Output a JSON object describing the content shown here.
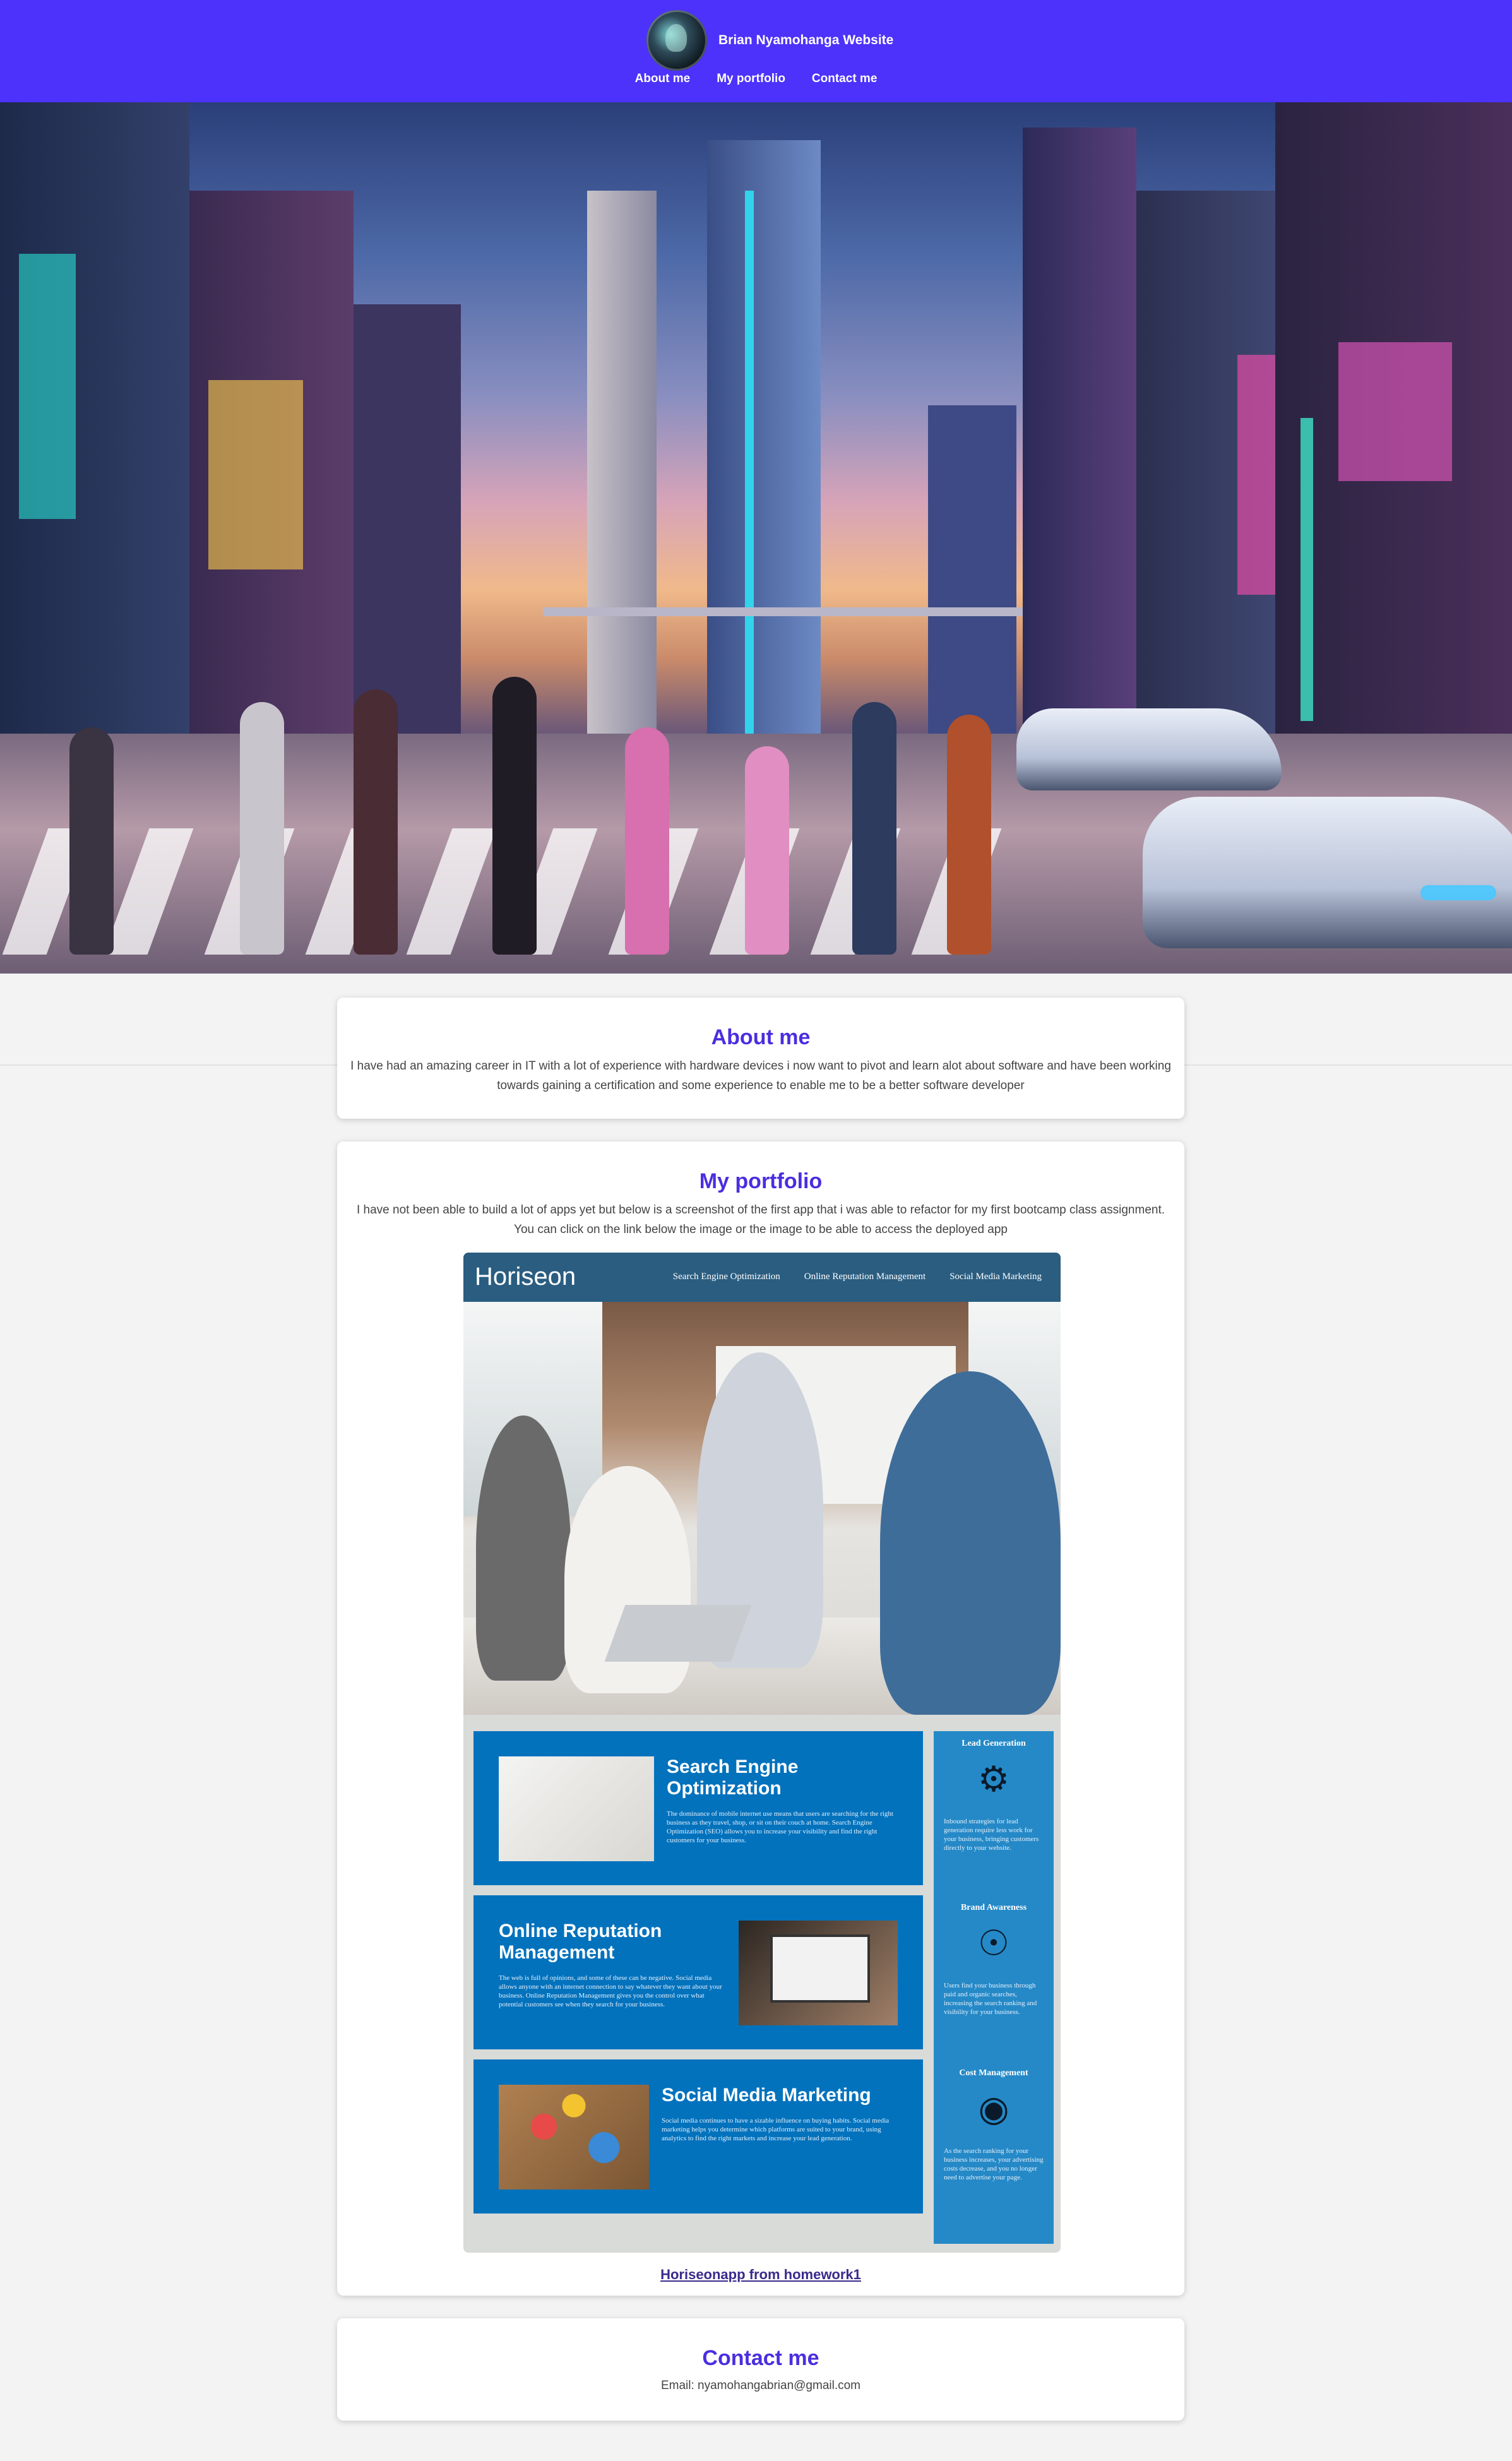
{
  "header": {
    "site_title": "Brian Nyamohanga Website",
    "nav": [
      "About me",
      "My portfolio",
      "Contact me"
    ]
  },
  "about": {
    "title": "About me",
    "text": "I have had an amazing career in IT with a lot of experience with hardware devices i now want to pivot and learn alot about software and have been working towards gaining a certification and some experience to enable me to be a better software developer"
  },
  "portfolio": {
    "title": "My portfolio",
    "text_line1": "I have not been able to build a lot of apps yet but below is a screenshot of the first app that i was able to refactor for my first bootcamp class assignment.",
    "text_line2": "You can click on the link below the image or the image to be able to access the deployed app",
    "link_label": "Horiseonapp from homework1",
    "screenshot": {
      "logo": "Horiseon",
      "nav": [
        "Search Engine Optimization",
        "Online Reputation Management",
        "Social Media Marketing"
      ],
      "services": [
        {
          "title": "Search Engine Optimization",
          "text": "The dominance of mobile internet use means that users are searching for the right business as they travel, shop, or sit on their couch at home. Search Engine Optimization (SEO) allows you to increase your visibility and find the right customers for your business."
        },
        {
          "title": "Online Reputation Management",
          "text": "The web is full of opinions, and some of these can be negative. Social media allows anyone with an internet connection to say whatever they want about your business. Online Reputation Management gives you the control over what potential customers see when they search for your business."
        },
        {
          "title": "Social Media Marketing",
          "text": "Social media continues to have a sizable influence on buying habits. Social media marketing helps you determine which platforms are suited to your brand, using analytics to find the right markets and increase your lead generation."
        }
      ],
      "benefits": [
        {
          "title": "Lead Generation",
          "icon": "lightbulb-icon",
          "text": "Inbound strategies for lead generation require less work for your business, bringing customers directly to your website."
        },
        {
          "title": "Brand Awareness",
          "icon": "broadcast-icon",
          "text": "Users find your business through paid and organic searches, increasing the search ranking and visibility for your business."
        },
        {
          "title": "Cost Management",
          "icon": "coins-icon",
          "text": "As the search ranking for your business increases, your advertising costs decrease, and you no longer need to advertise your page."
        }
      ]
    }
  },
  "contact": {
    "title": "Contact me",
    "email": "Email: nyamohangabrian@gmail.com"
  },
  "colors": {
    "header_bg": "#4c32fb",
    "heading": "#4a2ee0",
    "page_bg": "#f3f3f3",
    "horiseon_header": "#2a5d80",
    "horiseon_service": "#0272bd",
    "horiseon_benefit": "#2589c7"
  }
}
